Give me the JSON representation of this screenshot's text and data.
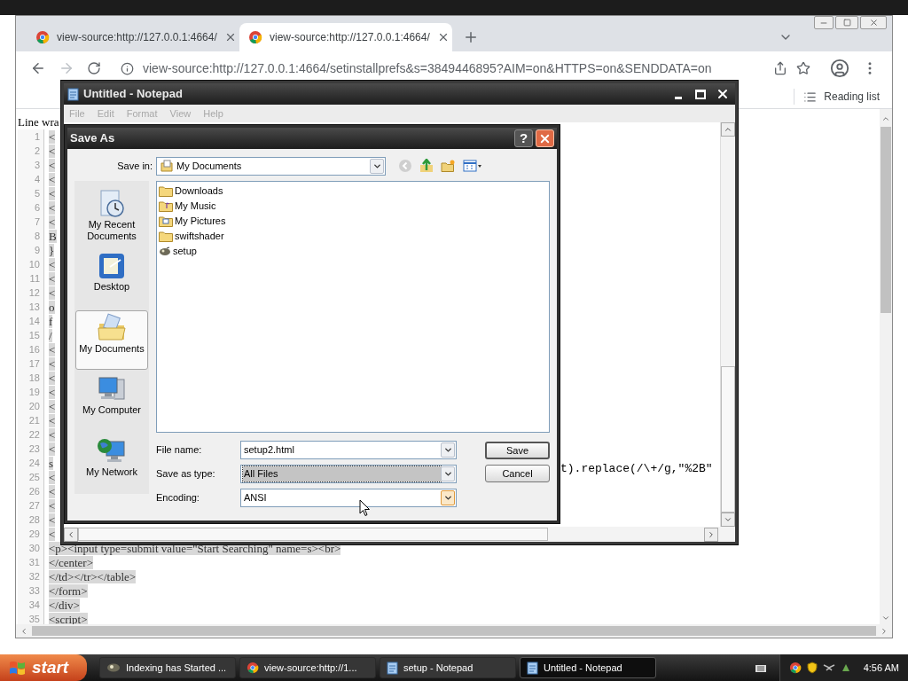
{
  "browser": {
    "tabs": [
      {
        "title": "view-source:http://127.0.0.1:4664/",
        "selected": false
      },
      {
        "title": "view-source:http://127.0.0.1:4664/",
        "selected": true
      }
    ],
    "address": "view-source:http://127.0.0.1:4664/setinstallprefs&s=3849446895?AIM=on&HTTPS=on&SENDDATA=on",
    "reading_list": "Reading list",
    "line_wrap_label": "Line wra",
    "source_lines": [
      {
        "number": "1",
        "text": "<"
      },
      {
        "number": "2",
        "text": "<"
      },
      {
        "number": "3",
        "text": "<"
      },
      {
        "number": "4",
        "text": "<"
      },
      {
        "number": "5",
        "text": "<"
      },
      {
        "number": "6",
        "text": "<"
      },
      {
        "number": "7",
        "text": "<"
      },
      {
        "number": "8",
        "text": "B"
      },
      {
        "number": "9",
        "text": "}"
      },
      {
        "number": "10",
        "text": "<"
      },
      {
        "number": "11",
        "text": "<"
      },
      {
        "number": "12",
        "text": "<"
      },
      {
        "number": "13",
        "text": "o"
      },
      {
        "number": "14",
        "text": "f"
      },
      {
        "number": "15",
        "text": "/"
      },
      {
        "number": "16",
        "text": "<"
      },
      {
        "number": "17",
        "text": "<"
      },
      {
        "number": "18",
        "text": "<"
      },
      {
        "number": "19",
        "text": "<"
      },
      {
        "number": "20",
        "text": "<"
      },
      {
        "number": "21",
        "text": "<"
      },
      {
        "number": "22",
        "text": "<"
      },
      {
        "number": "23",
        "text": "<"
      },
      {
        "number": "24",
        "text": "s"
      },
      {
        "number": "25",
        "text": "<"
      },
      {
        "number": "26",
        "text": "<"
      },
      {
        "number": "27",
        "text": "<"
      },
      {
        "number": "28",
        "text": "<"
      },
      {
        "number": "29",
        "text": "<"
      },
      {
        "number": "30",
        "text": "<p><input type=submit value=\"Start Searching\" name=s><br>"
      },
      {
        "number": "31",
        "text": "</center>"
      },
      {
        "number": "32",
        "text": "</td></tr></table>"
      },
      {
        "number": "33",
        "text": "</form>"
      },
      {
        "number": "34",
        "text": "</div>"
      },
      {
        "number": "35",
        "text": "<script>"
      }
    ]
  },
  "notepad": {
    "title": "Untitled - Notepad",
    "menu": [
      {
        "label": "File",
        "disabled": true
      },
      {
        "label": "Edit",
        "disabled": true
      },
      {
        "label": "Format",
        "disabled": true
      },
      {
        "label": "View",
        "disabled": true
      },
      {
        "label": "Help",
        "disabled": true
      }
    ],
    "visible_text": "t).replace(/\\+/g,\"%2B\""
  },
  "save_dialog": {
    "title": "Save As",
    "help": "?",
    "save_in_label": "Save in:",
    "save_in_value": "My Documents",
    "places": [
      {
        "label": "My Recent Documents",
        "kind": "recent",
        "selected": false
      },
      {
        "label": "Desktop",
        "kind": "desktop",
        "selected": false
      },
      {
        "label": "My Documents",
        "kind": "documents",
        "selected": true
      },
      {
        "label": "My Computer",
        "kind": "computer",
        "selected": false
      },
      {
        "label": "My Network",
        "kind": "network",
        "selected": false
      }
    ],
    "files": [
      {
        "name": "Downloads",
        "kind": "folder"
      },
      {
        "name": "My Music",
        "kind": "music"
      },
      {
        "name": "My Pictures",
        "kind": "pictures"
      },
      {
        "name": "swiftshader",
        "kind": "folder"
      },
      {
        "name": "setup",
        "kind": "program"
      }
    ],
    "fields": [
      {
        "label": "File name:",
        "value": "setup2.html",
        "selected": false,
        "hovered": false
      },
      {
        "label": "Save as type:",
        "value": "All Files",
        "selected": true,
        "hovered": false
      },
      {
        "label": "Encoding:",
        "value": "ANSI",
        "selected": false,
        "hovered": true
      }
    ],
    "buttons": [
      "Save",
      "Cancel"
    ]
  },
  "taskbar": {
    "start": "start",
    "tasks": [
      {
        "title": "Indexing has Started ...",
        "kind": "app",
        "selected": false
      },
      {
        "title": "view-source:http://1...",
        "kind": "browser",
        "selected": false
      },
      {
        "title": "setup - Notepad",
        "kind": "notepad",
        "selected": false
      },
      {
        "title": "Untitled - Notepad",
        "kind": "notepad",
        "selected": true
      }
    ],
    "clock": "4:56 AM"
  }
}
